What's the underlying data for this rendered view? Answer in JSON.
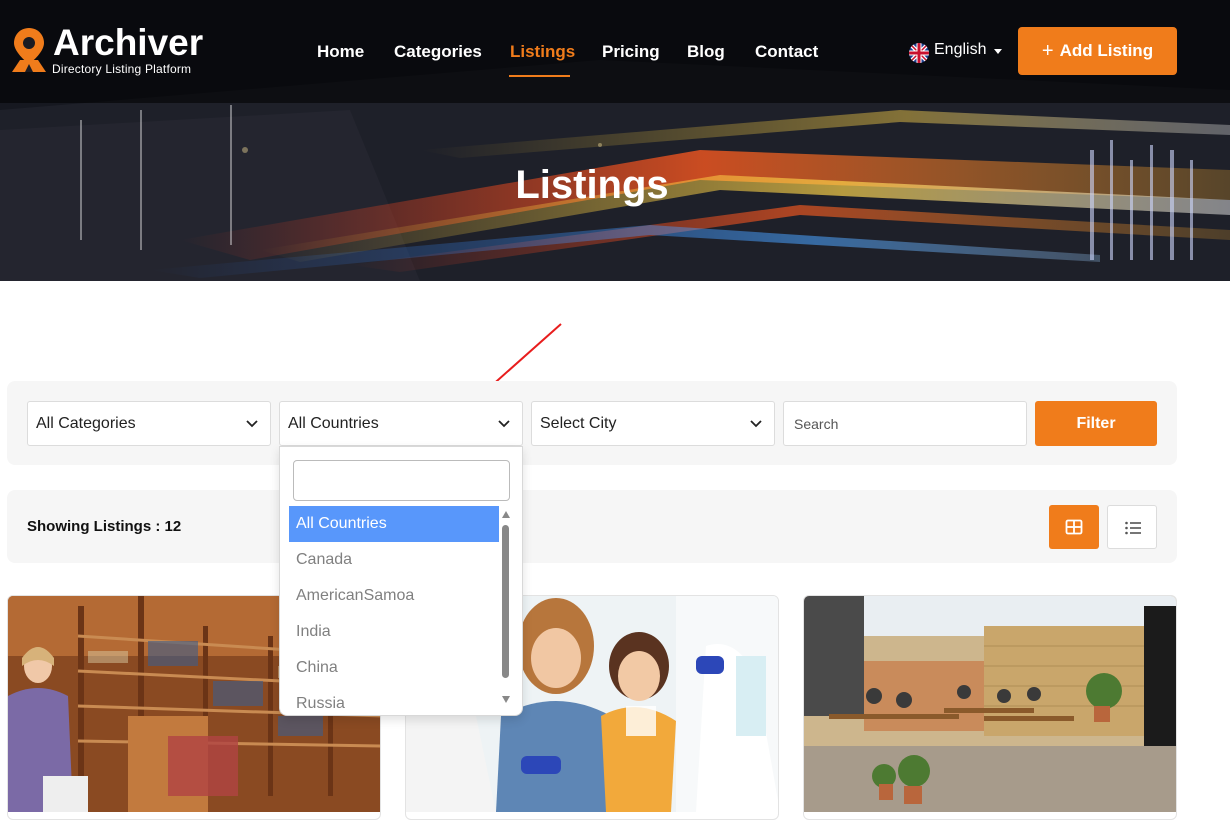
{
  "brand": {
    "name": "Archiver",
    "tagline": "Directory Listing Platform",
    "accent_color": "#f07c1b"
  },
  "nav": {
    "items": [
      {
        "label": "Home",
        "active": false
      },
      {
        "label": "Categories",
        "active": false
      },
      {
        "label": "Listings",
        "active": true
      },
      {
        "label": "Pricing",
        "active": false
      },
      {
        "label": "Blog",
        "active": false
      },
      {
        "label": "Contact",
        "active": false
      }
    ],
    "language": {
      "label": "English",
      "icon": "uk-flag-icon"
    },
    "add_listing_label": "Add Listing",
    "add_listing_icon": "plus-icon"
  },
  "hero": {
    "title": "Listings"
  },
  "filters": {
    "category": {
      "value": "All Categories"
    },
    "country": {
      "value": "All Countries"
    },
    "city": {
      "value": "Select City"
    },
    "search": {
      "placeholder": "Search",
      "value": ""
    },
    "filter_button": "Filter"
  },
  "country_dropdown": {
    "open": true,
    "search_value": "",
    "selected_color": "#5897fb",
    "options": [
      "All Countries",
      "Canada",
      "AmericanSamoa",
      "India",
      "China",
      "Russia"
    ]
  },
  "results": {
    "label": "Showing Listings : 12",
    "view_modes": [
      {
        "icon": "grid-icon",
        "active": true
      },
      {
        "icon": "list-icon",
        "active": false
      }
    ]
  },
  "cards": [
    {
      "image": "bookstore-photo"
    },
    {
      "image": "dentist-photo"
    },
    {
      "image": "beer-garden-photo"
    }
  ]
}
